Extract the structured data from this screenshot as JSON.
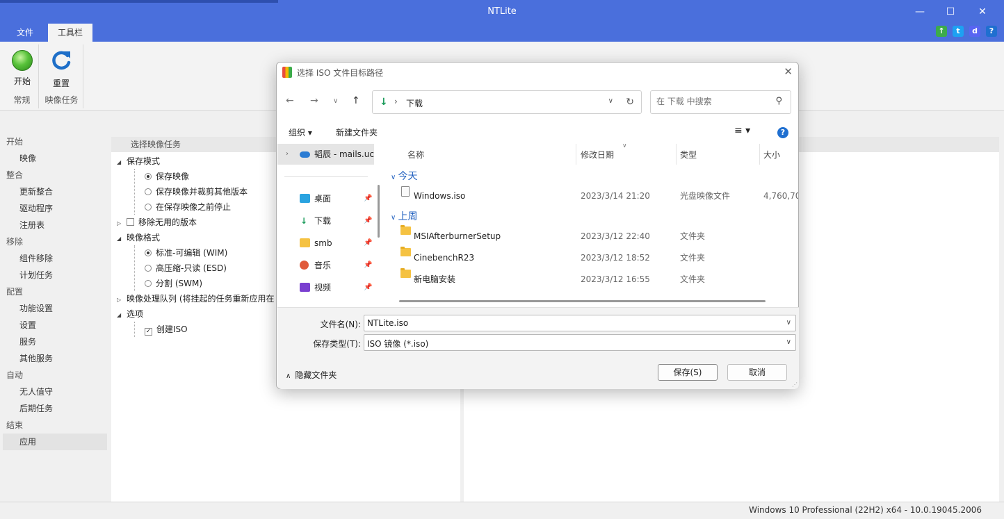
{
  "app": {
    "title": "NTLite"
  },
  "window_controls": {
    "minimize": "—",
    "maximize": "☐",
    "close": "✕"
  },
  "ribbon": {
    "tabs": [
      "文件",
      "工具栏"
    ],
    "buttons": [
      {
        "label": "开始",
        "icon": "green-orb-icon"
      },
      {
        "label": "重置",
        "icon": "refresh-icon"
      }
    ],
    "groups": [
      "常规",
      "映像任务"
    ]
  },
  "nav": {
    "sections": [
      {
        "title": "开始",
        "items": [
          "映像"
        ]
      },
      {
        "title": "整合",
        "items": [
          "更新整合",
          "驱动程序",
          "注册表"
        ]
      },
      {
        "title": "移除",
        "items": [
          "组件移除",
          "计划任务"
        ]
      },
      {
        "title": "配置",
        "items": [
          "功能设置",
          "设置",
          "服务",
          "其他服务"
        ]
      },
      {
        "title": "自动",
        "items": [
          "无人值守",
          "后期任务"
        ]
      },
      {
        "title": "结束",
        "items": [
          "应用"
        ]
      }
    ],
    "selected": "应用"
  },
  "panel": {
    "header": "选择映像任务",
    "tree": {
      "save_mode": "保存模式",
      "save_image": "保存映像",
      "save_trim": "保存映像并裁剪其他版本",
      "stop_before": "在保存映像之前停止",
      "remove_unused": "移除无用的版本",
      "image_format": "映像格式",
      "fmt_wim": "标准-可编辑 (WIM)",
      "fmt_esd": "高压缩-只读 (ESD)",
      "fmt_swm": "分割 (SWM)",
      "queue": "映像处理队列 (将挂起的任务重新应用在",
      "options": "选项",
      "create_iso": "创建ISO"
    }
  },
  "status": {
    "text": "Windows 10 Professional (22H2) x64 - 10.0.19045.2006"
  },
  "dialog": {
    "title": "选择 ISO 文件目标路径",
    "address": {
      "separator": "›",
      "path": "下载"
    },
    "search_placeholder": "在 下载 中搜索",
    "toolbar": {
      "organize": "组织 ▾",
      "new_folder": "新建文件夹",
      "help": "?",
      "view_icon": "≡ ▾"
    },
    "sidebar": [
      {
        "label": "韬辰 - mails.uc",
        "icon": "onedrive-icon",
        "color": "#2b7cd3"
      },
      {
        "label": "桌面",
        "icon": "desktop-icon",
        "color": "#2aa3e0"
      },
      {
        "label": "下载",
        "icon": "download-icon",
        "color": "#1a9b5a"
      },
      {
        "label": "smb",
        "icon": "folder-icon",
        "color": "#f5c242"
      },
      {
        "label": "音乐",
        "icon": "music-icon",
        "color": "#e05a3a"
      },
      {
        "label": "视频",
        "icon": "video-icon",
        "color": "#7a3fd0"
      }
    ],
    "columns": [
      "名称",
      "修改日期",
      "类型",
      "大小"
    ],
    "groups": [
      {
        "name": "今天",
        "files": [
          {
            "name": "Windows.iso",
            "date": "2023/3/14 21:20",
            "type": "光盘映像文件",
            "size": "4,760,70",
            "icon": "file-icon"
          }
        ]
      },
      {
        "name": "上周",
        "files": [
          {
            "name": "MSIAfterburnerSetup",
            "date": "2023/3/12 22:40",
            "type": "文件夹",
            "size": "",
            "icon": "folder-icon"
          },
          {
            "name": "CinebenchR23",
            "date": "2023/3/12 18:52",
            "type": "文件夹",
            "size": "",
            "icon": "folder-icon"
          },
          {
            "name": "新电脑安装",
            "date": "2023/3/12 16:55",
            "type": "文件夹",
            "size": "",
            "icon": "folder-icon"
          }
        ]
      }
    ],
    "filename_label": "文件名(N):",
    "filename_value": "NTLite.iso",
    "filetype_label": "保存类型(T):",
    "filetype_value": "ISO 镜像 (*.iso)",
    "hide_folders": "隐藏文件夹",
    "save": "保存(S)",
    "cancel": "取消"
  },
  "colors": {
    "accent": "#4a6fdc",
    "link": "#1f5fbf"
  }
}
